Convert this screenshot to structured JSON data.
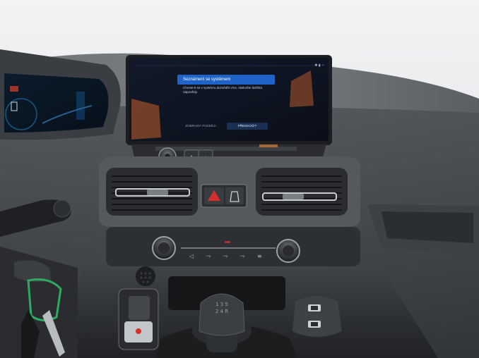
{
  "photo": {
    "description_free": true
  },
  "infotainment": {
    "popup": {
      "title": "Seznámení se systémem",
      "body": "Chcete-li se v systému dozvědět více, stiskněte tlačítko nápovědy.",
      "buttons": {
        "later": "ZOBRAZIT POZDĚJI",
        "next": "PŘESKOČIT"
      }
    },
    "status_icons": [
      "bluetooth-icon",
      "signal-icon",
      "wifi-icon"
    ]
  },
  "gear_knob": {
    "pattern": "1 3 5\n2 4 R"
  }
}
